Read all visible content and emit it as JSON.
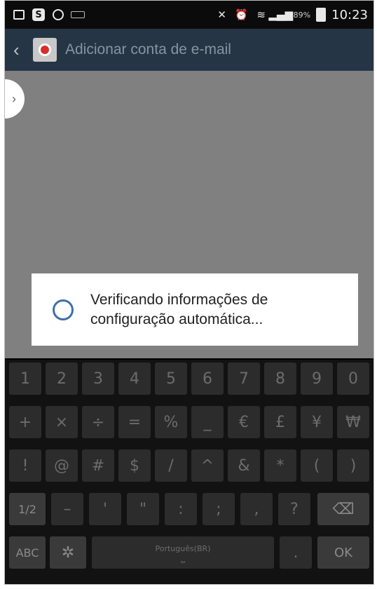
{
  "status_bar": {
    "battery": "89%",
    "time": "10:23",
    "icons": [
      "gallery-icon",
      "skype-icon",
      "whatsapp-icon",
      "keyboard-icon",
      "mute-icon",
      "alarm-icon",
      "wifi-icon",
      "signal-icon",
      "battery-icon"
    ]
  },
  "action_bar": {
    "title": "Adicionar conta de e-mail",
    "back_glyph": "‹"
  },
  "dialog": {
    "message_line1": "Verificando informações de",
    "message_line2": "configuração automática..."
  },
  "keyboard": {
    "row1": [
      "1",
      "2",
      "3",
      "4",
      "5",
      "6",
      "7",
      "8",
      "9",
      "0"
    ],
    "row2": [
      "+",
      "×",
      "÷",
      "=",
      "%",
      "_",
      "€",
      "£",
      "¥",
      "₩"
    ],
    "row3": [
      "!",
      "@",
      "#",
      "$",
      "/",
      "^",
      "&",
      "*",
      "(",
      ")"
    ],
    "row4": [
      "1/2",
      "–",
      "'",
      "\"",
      ":",
      ";",
      ",",
      "?",
      "⌫"
    ],
    "row5": {
      "abc": "ABC",
      "space": "Português(BR)",
      "period": ".",
      "ok": "OK"
    }
  },
  "colors": {
    "action_bar": "#263545",
    "content_bg": "#808080",
    "keyboard_bg": "#121212",
    "key_bg": "#2c2c2c",
    "spinner": "#3f6fae"
  }
}
